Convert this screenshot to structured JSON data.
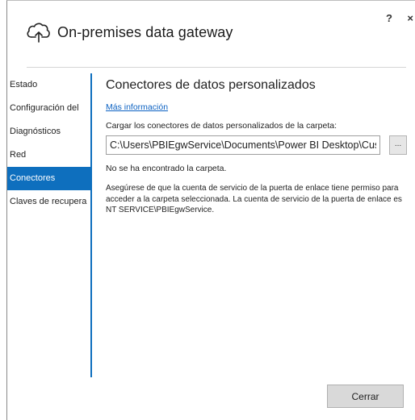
{
  "window": {
    "title": "On-premises data gateway",
    "help_label": "?",
    "close_label": "×"
  },
  "sidebar": {
    "items": [
      {
        "label": "Estado",
        "active": false
      },
      {
        "label": "Configuración del",
        "active": false
      },
      {
        "label": "Diagnósticos",
        "active": false
      },
      {
        "label": "Red",
        "active": false
      },
      {
        "label": "Conectores",
        "active": true
      },
      {
        "label": "Claves de recupera",
        "active": false
      }
    ]
  },
  "main": {
    "section_title": "Conectores de datos personalizados",
    "more_info_link": "Más información",
    "folder_label": "Cargar los conectores de datos personalizados de la carpeta:",
    "folder_path": "C:\\Users\\PBIEgwService\\Documents\\Power BI Desktop\\Custom",
    "browse_label": "...",
    "status_message": "No se ha encontrado la carpeta.",
    "note_lines": [
      "Asegúrese de que la cuenta de servicio de la puerta de enlace tiene permiso para",
      "acceder a la carpeta seleccionada. La cuenta de servicio de la puerta de enlace es",
      "NT SERVICE\\PBIEgwService."
    ]
  },
  "footer": {
    "close_button": "Cerrar"
  },
  "colors": {
    "accent": "#0e6fbe",
    "link": "#0b61c2",
    "button_bg": "#d9d9d9"
  }
}
